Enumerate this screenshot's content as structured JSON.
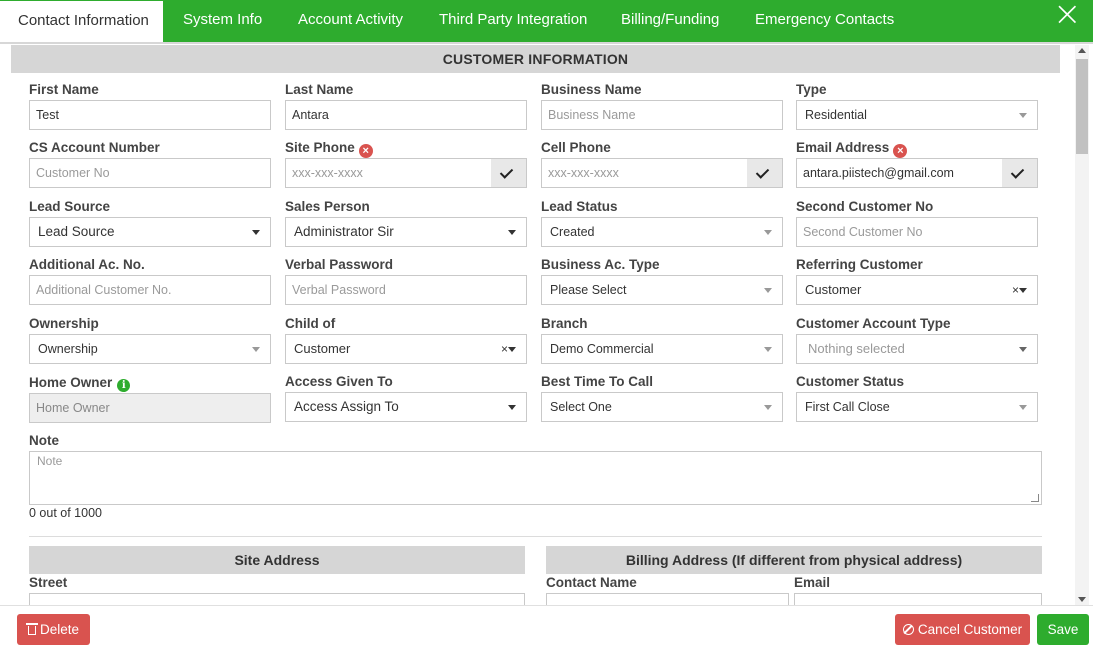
{
  "tabs": [
    {
      "label": "Contact Information"
    },
    {
      "label": "System Info"
    },
    {
      "label": "Account Activity"
    },
    {
      "label": "Third Party Integration"
    },
    {
      "label": "Billing/Funding"
    },
    {
      "label": "Emergency Contacts"
    }
  ],
  "section_title": "CUSTOMER  INFORMATION",
  "fields": {
    "first_name": {
      "label": "First Name",
      "value": "Test"
    },
    "last_name": {
      "label": "Last Name",
      "value": "Antara"
    },
    "business_name": {
      "label": "Business Name",
      "placeholder": "Business Name"
    },
    "type": {
      "label": "Type",
      "value": "Residential"
    },
    "cs_account_number": {
      "label": "CS Account Number",
      "placeholder": "Customer No"
    },
    "site_phone": {
      "label": "Site Phone",
      "placeholder": "xxx-xxx-xxxx"
    },
    "cell_phone": {
      "label": "Cell Phone",
      "placeholder": "xxx-xxx-xxxx"
    },
    "email": {
      "label": "Email Address",
      "value": "antara.piistech@gmail.com"
    },
    "lead_source": {
      "label": "Lead Source",
      "value": "Lead Source"
    },
    "sales_person": {
      "label": "Sales Person",
      "value": "Administrator Sir"
    },
    "lead_status": {
      "label": "Lead Status",
      "value": "Created"
    },
    "second_customer_no": {
      "label": "Second Customer No",
      "placeholder": "Second Customer No"
    },
    "additional_ac_no": {
      "label": "Additional Ac. No.",
      "placeholder": "Additional Customer No."
    },
    "verbal_password": {
      "label": "Verbal Password",
      "placeholder": "Verbal Password"
    },
    "business_ac_type": {
      "label": "Business Ac. Type",
      "value": "Please Select"
    },
    "referring_customer": {
      "label": "Referring Customer",
      "value": "Customer"
    },
    "ownership": {
      "label": "Ownership",
      "value": "Ownership"
    },
    "child_of": {
      "label": "Child of",
      "value": "Customer"
    },
    "branch": {
      "label": "Branch",
      "value": "Demo Commercial"
    },
    "customer_account_type": {
      "label": "Customer Account Type",
      "value": "Nothing selected"
    },
    "home_owner": {
      "label": "Home Owner",
      "placeholder": "Home Owner"
    },
    "access_given_to": {
      "label": "Access Given To",
      "value": "Access Assign To"
    },
    "best_time_to_call": {
      "label": "Best Time To Call",
      "value": "Select One"
    },
    "customer_status": {
      "label": "Customer Status",
      "value": "First Call Close"
    },
    "note": {
      "label": "Note",
      "placeholder": "Note",
      "counter": "0 out of 1000"
    }
  },
  "site_address": {
    "title": "Site Address",
    "street_label": "Street"
  },
  "billing_address": {
    "title": "Billing Address (If different from physical address)",
    "contact_name_label": "Contact Name",
    "email_label": "Email"
  },
  "glyphs": {
    "error": "×",
    "info": "i",
    "clear": "×",
    "close": "×"
  },
  "footer": {
    "delete_label": "Delete",
    "cancel_label": "Cancel Customer",
    "save_label": "Save"
  },
  "colors": {
    "brand_green": "#2eac2e",
    "danger_red": "#d9534f",
    "section_gray": "#d6d6d6"
  }
}
